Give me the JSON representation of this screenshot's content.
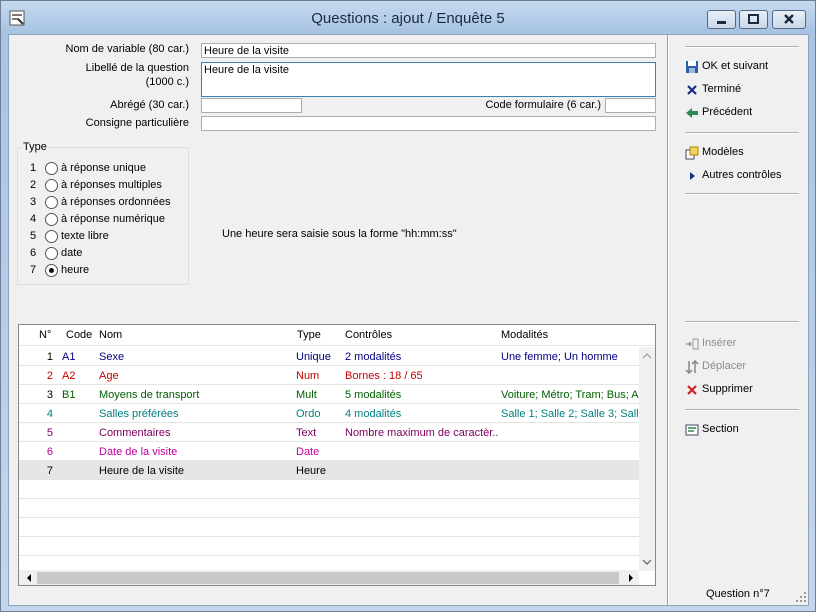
{
  "window": {
    "title": "Questions : ajout / Enquête 5"
  },
  "form": {
    "nom_label": "Nom de variable (80 car.)",
    "nom_value": "Heure de la visite",
    "libelle_label_1": "Libellé de la question",
    "libelle_label_2": "(1000 c.)",
    "libelle_value": "Heure de la visite",
    "abrege_label": "Abrégé (30 car.)",
    "abrege_value": "",
    "code_form_label": "Code formulaire  (6 car.)",
    "code_form_value": "",
    "consigne_label": "Consigne particulière",
    "consigne_value": ""
  },
  "type": {
    "legend": "Type",
    "options": [
      {
        "num": "1",
        "label": "à réponse unique",
        "selected": false
      },
      {
        "num": "2",
        "label": "à réponses multiples",
        "selected": false
      },
      {
        "num": "3",
        "label": "à réponses ordonnées",
        "selected": false
      },
      {
        "num": "4",
        "label": "à réponse numérique",
        "selected": false
      },
      {
        "num": "5",
        "label": "texte libre",
        "selected": false
      },
      {
        "num": "6",
        "label": "date",
        "selected": false
      },
      {
        "num": "7",
        "label": "heure",
        "selected": true
      }
    ]
  },
  "hint": "Une heure sera saisie sous la forme \"hh:mm:ss\"",
  "table": {
    "headers": {
      "n": "N°",
      "code": "Code",
      "nom": "Nom",
      "type": "Type",
      "ctrl": "Contrôles",
      "mod": "Modalités"
    },
    "rows": [
      {
        "n": "1",
        "code": "A1",
        "nom": "Sexe",
        "type": "Unique",
        "ctrl": "2 modalités",
        "mod": "Une femme; Un homme",
        "color": "#000080"
      },
      {
        "n": "2",
        "code": "A2",
        "nom": "Age",
        "type": "Num",
        "ctrl": "Bornes : 18 / 65",
        "mod": "",
        "color": "#c00000"
      },
      {
        "n": "3",
        "code": "B1",
        "nom": "Moyens de transport",
        "type": "Mult",
        "ctrl": "5 modalités",
        "mod": "Voiture; Métro; Tram; Bus; A",
        "color": "#006000"
      },
      {
        "n": "4",
        "code": "",
        "nom": "Salles préférées",
        "type": "Ordo",
        "ctrl": "4 modalités",
        "mod": "Salle 1; Salle 2; Salle 3; Salle",
        "color": "#008080"
      },
      {
        "n": "5",
        "code": "",
        "nom": "Commentaires",
        "type": "Text",
        "ctrl": "Nombre maximum de caractèr...",
        "mod": "",
        "color": "#800060"
      },
      {
        "n": "6",
        "code": "",
        "nom": "Date de la visite",
        "type": "Date",
        "ctrl": "",
        "mod": "",
        "color": "#c000a0"
      },
      {
        "n": "7",
        "code": "",
        "nom": "Heure de la visite",
        "type": "Heure",
        "ctrl": "",
        "mod": "",
        "color": "#000000"
      }
    ]
  },
  "sidebar": {
    "ok": "OK et suivant",
    "termine": "Terminé",
    "precedent": "Précédent",
    "modeles": "Modèles",
    "autres": "Autres contrôles",
    "inserer": "Insérer",
    "deplacer": "Déplacer",
    "supprimer": "Supprimer",
    "section": "Section"
  },
  "status": "Question n°7"
}
